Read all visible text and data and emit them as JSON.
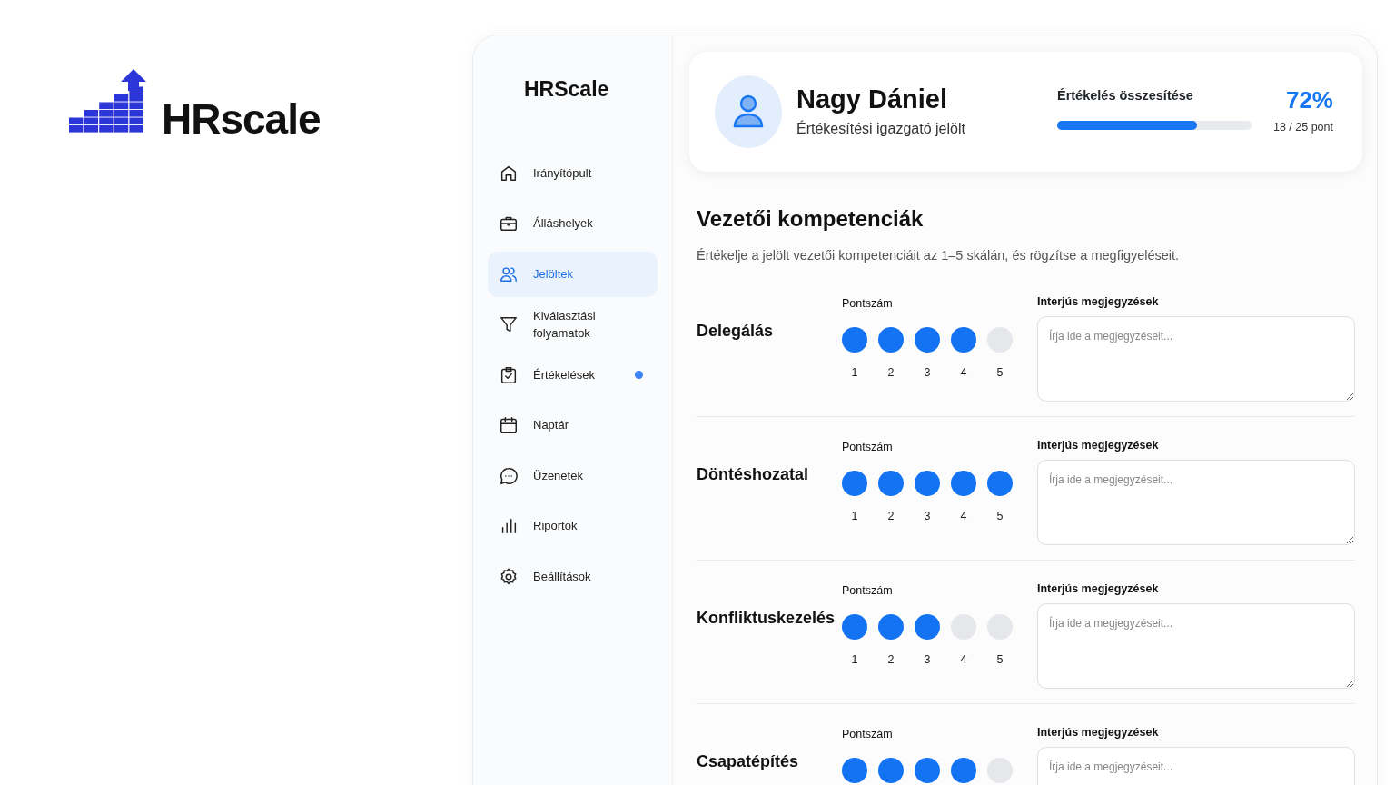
{
  "brand": {
    "name": "HRscale"
  },
  "sidebar": {
    "title": "HRScale",
    "items": [
      {
        "label": "Irányítópult",
        "selected": false,
        "notification": false
      },
      {
        "label": "Álláshelyek",
        "selected": false,
        "notification": false
      },
      {
        "label": "Jelöltek",
        "selected": true,
        "notification": false
      },
      {
        "label": "Kiválasztási folyamatok",
        "selected": false,
        "notification": false
      },
      {
        "label": "Értékelések",
        "selected": false,
        "notification": true
      },
      {
        "label": "Naptár",
        "selected": false,
        "notification": false
      },
      {
        "label": "Üzenetek",
        "selected": false,
        "notification": false
      },
      {
        "label": "Riportok",
        "selected": false,
        "notification": false
      },
      {
        "label": "Beállítások",
        "selected": false,
        "notification": false
      }
    ]
  },
  "candidate": {
    "name": "Nagy Dániel",
    "role": "Értékesítési igazgató jelölt",
    "summary_label": "Értékelés összesítése",
    "percent": "72%",
    "level": 0.72,
    "points": "18 / 25 pont"
  },
  "section": {
    "title": "Vezetői kompetenciák",
    "description": "Értékelje a jelölt vezetői kompetenciáit az 1–5 skálán, és rögzítse a megfigyeléseit."
  },
  "competencies": [
    {
      "name": "Delegálás",
      "score_label": "Pontszám",
      "notes_label": "Interjús megjegyzések",
      "placeholder": "Írja ide a megjegyzéseit...",
      "scale": [
        {
          "label": "1",
          "filled": true
        },
        {
          "label": "2",
          "filled": true
        },
        {
          "label": "3",
          "filled": true
        },
        {
          "label": "4",
          "filled": true
        },
        {
          "label": "5",
          "filled": false
        }
      ]
    },
    {
      "name": "Döntéshozatal",
      "score_label": "Pontszám",
      "notes_label": "Interjús megjegyzések",
      "placeholder": "Írja ide a megjegyzéseit...",
      "scale": [
        {
          "label": "1",
          "filled": true
        },
        {
          "label": "2",
          "filled": true
        },
        {
          "label": "3",
          "filled": true
        },
        {
          "label": "4",
          "filled": true
        },
        {
          "label": "5",
          "filled": true
        }
      ]
    },
    {
      "name": "Konfliktuskezelés",
      "score_label": "Pontszám",
      "notes_label": "Interjús megjegyzések",
      "placeholder": "Írja ide a megjegyzéseit...",
      "scale": [
        {
          "label": "1",
          "filled": true
        },
        {
          "label": "2",
          "filled": true
        },
        {
          "label": "3",
          "filled": true
        },
        {
          "label": "4",
          "filled": false
        },
        {
          "label": "5",
          "filled": false
        }
      ]
    },
    {
      "name": "Csapatépítés",
      "score_label": "Pontszám",
      "notes_label": "Interjús megjegyzések",
      "placeholder": "Írja ide a megjegyzéseit...",
      "scale": [
        {
          "filled": true
        },
        {
          "filled": true
        },
        {
          "filled": true
        },
        {
          "filled": true
        },
        {
          "filled": false
        }
      ]
    }
  ]
}
